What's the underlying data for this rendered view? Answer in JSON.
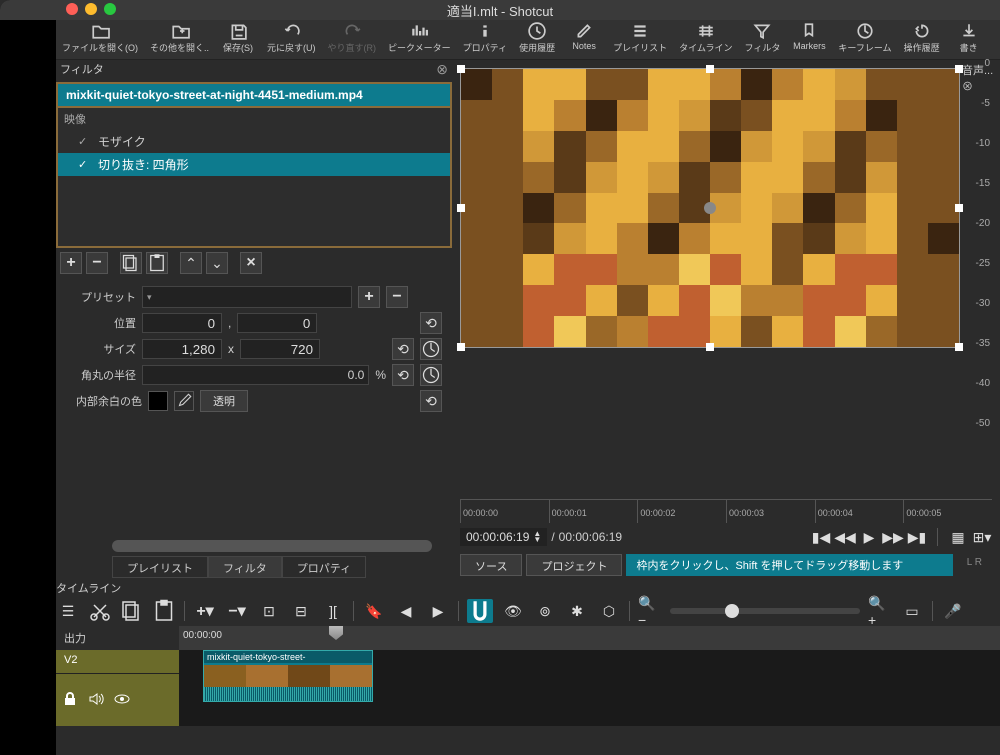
{
  "window": {
    "title": "適当I.mlt - Shotcut"
  },
  "toolbar": [
    {
      "label": "ファイルを開く(O)",
      "icon": "folder"
    },
    {
      "label": "その他を開く..",
      "icon": "folder-plus"
    },
    {
      "label": "保存(S)",
      "icon": "save"
    },
    {
      "label": "元に戻す(U)",
      "icon": "undo"
    },
    {
      "label": "やり直す(R)",
      "icon": "redo",
      "disabled": true
    },
    {
      "label": "ピークメーター",
      "icon": "bars"
    },
    {
      "label": "プロパティ",
      "icon": "info"
    },
    {
      "label": "使用履歴",
      "icon": "clock"
    },
    {
      "label": "Notes",
      "icon": "edit"
    },
    {
      "label": "プレイリスト",
      "icon": "list"
    },
    {
      "label": "タイムライン",
      "icon": "timeline"
    },
    {
      "label": "フィルタ",
      "icon": "filter"
    },
    {
      "label": "Markers",
      "icon": "marker"
    },
    {
      "label": "キーフレーム",
      "icon": "keyframe"
    },
    {
      "label": "操作履歴",
      "icon": "history"
    },
    {
      "label": "書き",
      "icon": "export"
    }
  ],
  "filters_panel": {
    "title": "フィルタ",
    "clip_name": "mixkit-quiet-tokyo-street-at-night-4451-medium.mp4",
    "category": "映像",
    "items": [
      {
        "label": "モザイク",
        "checked": true,
        "selected": false
      },
      {
        "label": "切り抜き: 四角形",
        "checked": true,
        "selected": true
      }
    ]
  },
  "params": {
    "preset_label": "プリセット",
    "pos_label": "位置",
    "pos_x": "0",
    "pos_y": "0",
    "pos_sep": ",",
    "size_label": "サイズ",
    "size_w": "1,280",
    "size_h": "720",
    "size_sep": "x",
    "radius_label": "角丸の半径",
    "radius_val": "0.0",
    "radius_unit": "%",
    "padcolor_label": "内部余白の色",
    "transparent": "透明"
  },
  "left_tabs": [
    "プレイリスト",
    "フィルタ",
    "プロパティ"
  ],
  "audio_panel": {
    "title": "音声... ⊗",
    "ticks": [
      "0",
      "-5",
      "-10",
      "-15",
      "-20",
      "-25",
      "-30",
      "-35",
      "-40",
      "-50"
    ]
  },
  "ruler_ticks": [
    "00:00:00",
    "00:00:01",
    "00:00:02",
    "00:00:03",
    "00:00:04",
    "00:00:05"
  ],
  "playback": {
    "current": "00:00:06:19",
    "duration": "00:00:06:19",
    "sep": " / "
  },
  "hint": {
    "source": "ソース",
    "project": "プロジェクト",
    "text": "枠内をクリックし、Shift を押してドラッグ移動します",
    "lr": "L  R"
  },
  "timeline": {
    "title": "タイムライン",
    "output": "出力",
    "v2": "V2",
    "ruler_start": "00:00:00",
    "clip_name": "mixkit-quiet-tokyo-street-"
  }
}
